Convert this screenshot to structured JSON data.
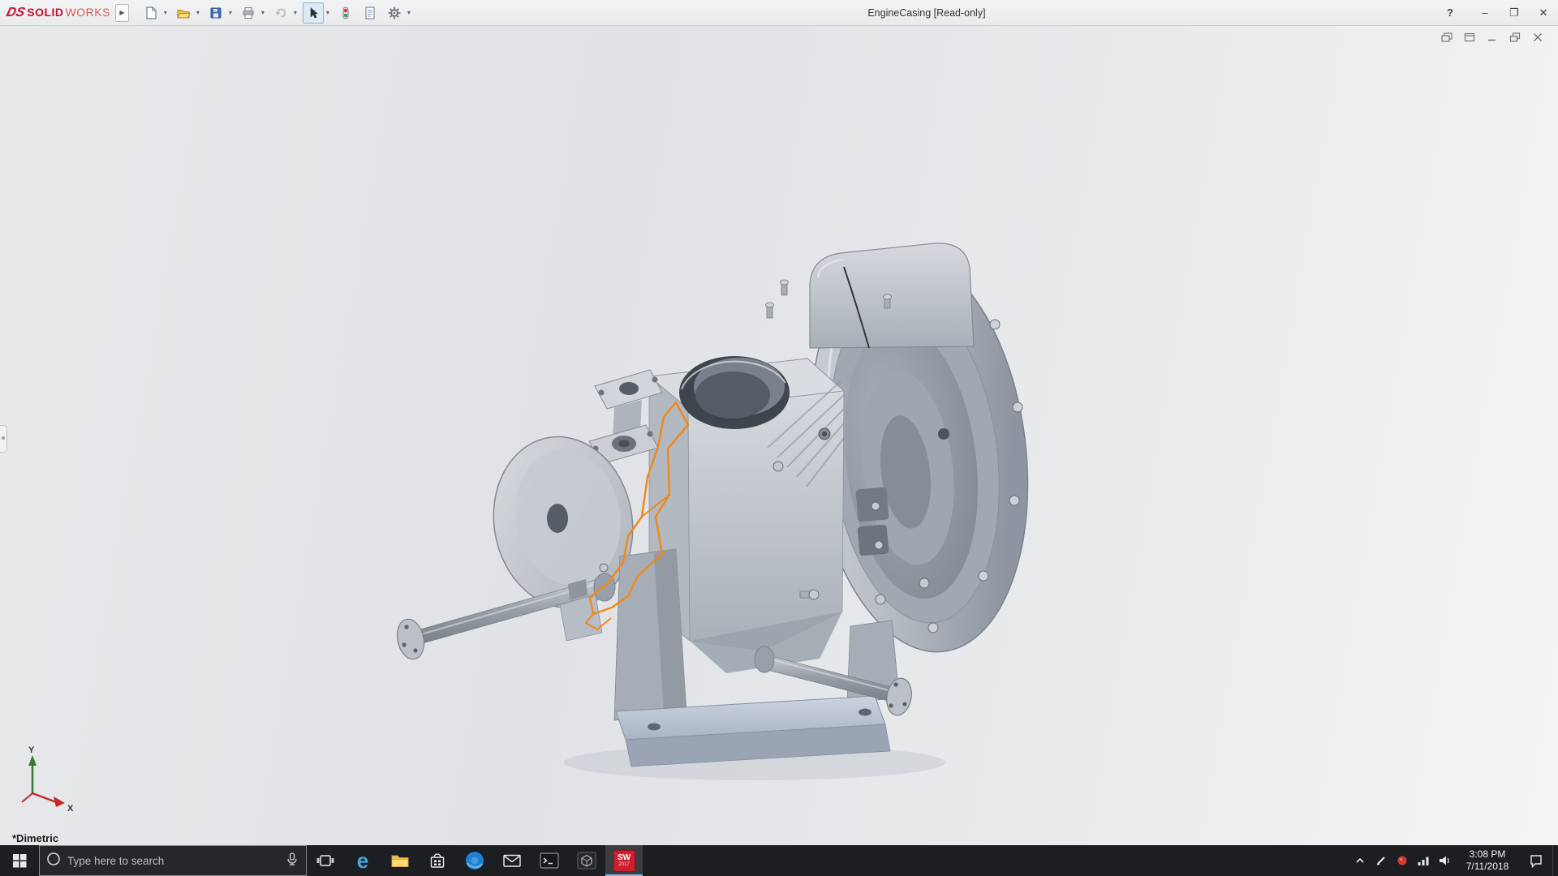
{
  "titlebar": {
    "brand": {
      "ds": "DS",
      "solid": "SOLID",
      "works": "WORKS"
    },
    "flyout": "▶",
    "title": "EngineCasing [Read-only]",
    "controls": {
      "help": "?",
      "minimize": "–",
      "maximize": "❐",
      "close": "✕"
    }
  },
  "toolbar": {
    "caret": "▾",
    "items": [
      {
        "name": "new-document",
        "caret": true
      },
      {
        "name": "open",
        "caret": true
      },
      {
        "name": "save",
        "caret": true
      },
      {
        "name": "print",
        "caret": true
      },
      {
        "name": "undo",
        "caret": true,
        "disabled": true
      },
      {
        "name": "select",
        "caret": true,
        "active": true
      },
      {
        "name": "rebuild",
        "caret": false
      },
      {
        "name": "file-properties",
        "caret": false
      },
      {
        "name": "options",
        "caret": true
      }
    ]
  },
  "viewport": {
    "view_label": "*Dimetric",
    "triad": {
      "y": "Y",
      "x": "X"
    },
    "sketch_highlight_color": "#ef8a1d"
  },
  "taskbar": {
    "search_placeholder": "Type here to search",
    "edge_letter": "e",
    "sw": {
      "label": "SW",
      "year": "2017"
    },
    "clock": {
      "time": "3:08 PM",
      "date": "7/11/2018"
    }
  },
  "icons": {
    "titlebar": [
      "flyout-arrow-icon",
      "new-document-icon",
      "open-icon",
      "save-icon",
      "print-icon",
      "undo-icon",
      "select-cursor-icon",
      "rebuild-icon",
      "file-properties-icon",
      "options-gear-icon",
      "help-icon",
      "minimize-icon",
      "maximize-icon",
      "close-icon"
    ],
    "doc_window": [
      "doc-cascade-icon",
      "doc-window-icon",
      "doc-minimize-icon",
      "doc-restore-icon",
      "doc-close-icon"
    ],
    "taskbar": [
      "start-icon",
      "cortana-circle-icon",
      "microphone-icon",
      "task-view-icon",
      "edge-icon",
      "file-explorer-icon",
      "store-icon",
      "round-blue-app-icon",
      "mail-icon",
      "terminal-icon",
      "cad-app-icon",
      "solidworks-app-icon",
      "tray-caret-icon",
      "pen-icon",
      "red-status-icon",
      "network-icon",
      "volume-icon",
      "action-center-icon",
      "show-desktop-icon"
    ]
  },
  "colors": {
    "sketch_orange": "#ef8a1d",
    "sw_red": "#cf1f2f",
    "taskbar_bg": "#1d1e22",
    "titlebar_bg": "#eef0f1",
    "metal_light": "#d9dce1",
    "metal_dark": "#9aa0aa"
  }
}
